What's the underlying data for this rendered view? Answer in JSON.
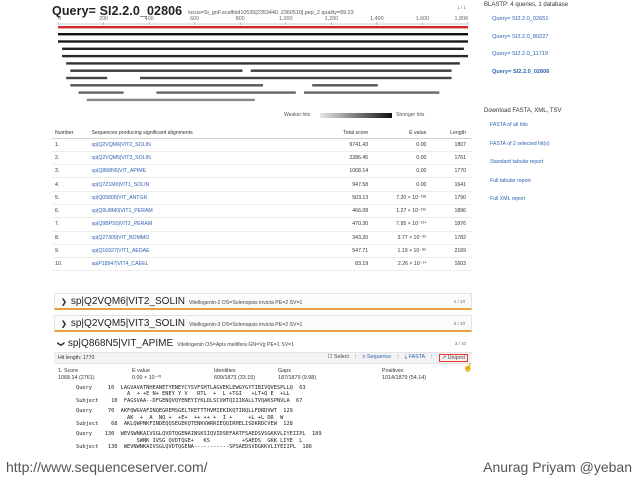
{
  "query": {
    "title": "Query= SI2.2.0_02806",
    "meta": "locus=Si_gnF.scaffold10535[2353440..2360510].pep_2 quality=99.23",
    "nav": "1 / 1",
    "axis_ticks": [
      "0",
      "200",
      "400",
      "600",
      "800",
      "1,000",
      "1,200",
      "1,400",
      "1,600",
      "1,808"
    ],
    "legend_weak": "Weaker hits",
    "legend_strong": "Stronger hits"
  },
  "hits_table": {
    "headers": [
      "Number",
      "Sequences producing significant alignments",
      "Total score",
      "E value",
      "Length"
    ],
    "rows": [
      {
        "num": "1.",
        "acc": "sp|Q2VQM6|VIT2_SOLIN",
        "score": "9741.43",
        "evalue": "0.00",
        "length": "1807"
      },
      {
        "num": "2.",
        "acc": "sp|Q2VQM5|VIT3_SOLIN",
        "score": "2286.45",
        "evalue": "0.00",
        "length": "1761"
      },
      {
        "num": "3.",
        "acc": "sp|Q868N5|VIT_APIME",
        "score": "1068.14",
        "evalue": "0.00",
        "length": "1770"
      },
      {
        "num": "4.",
        "acc": "sp|Q7Z1M0|VIT1_SOLIN",
        "score": "947.58",
        "evalue": "0.00",
        "length": "1641"
      },
      {
        "num": "5.",
        "acc": "sp|Q05808|VIT_ANTGR",
        "score": "503.13",
        "evalue": "7.20 × 10⁻¹³⁸",
        "length": "1790"
      },
      {
        "num": "6.",
        "acc": "sp|Q9U8M0|VIT1_PERAM",
        "score": "466.08",
        "evalue": "1.27 × 10⁻¹²⁶",
        "length": "1896"
      },
      {
        "num": "7.",
        "acc": "sp|Q9BPS0|VIT2_PERAM",
        "score": "470.30",
        "evalue": "7.95 × 10⁻¹²⁴",
        "length": "1876"
      },
      {
        "num": "8.",
        "acc": "sp|Q27309|VIT_BOMMO",
        "score": "343.20",
        "evalue": "3.77 × 10⁻⁹⁰",
        "length": "1782"
      },
      {
        "num": "9.",
        "acc": "sp|Q16927|VIT1_AEDAE",
        "score": "547.71",
        "evalue": "1.19 × 10⁻⁸⁶",
        "length": "2169"
      },
      {
        "num": "10.",
        "acc": "sp|P18947|VIT4_CAEEL",
        "score": "83.19",
        "evalue": "2.26 × 10⁻¹⁴",
        "length": "1603"
      }
    ]
  },
  "hit_panels": [
    {
      "acc": "sp|Q2VQM6|VIT2_SOLIN",
      "desc": "Vitellogenin-2 OS=Solenopsis invicta PE=2 SV=1",
      "count": "1 / 10"
    },
    {
      "acc": "sp|Q2VQM5|VIT3_SOLIN",
      "desc": "Vitellogenin-3 OS=Solenopsis invicta PE=2 SV=1",
      "count": "2 / 10"
    }
  ],
  "expanded_hit": {
    "acc": "sp|Q868N5|VIT_APIME",
    "desc": "Vitellogenin OS=Apis mellifera GN=Vg PE=1 SV=1",
    "count": "3 / 10",
    "length": "Hit length: 1770",
    "actions": {
      "select": "Select",
      "sequence": "Sequence",
      "fasta": "FASTA",
      "uniprot": "Uniprot"
    },
    "stats_labels": [
      "1. Score",
      "E value",
      "Identities",
      "Gaps",
      "Positives"
    ],
    "stats_values": [
      "1068.14 (2761)",
      "0.00 × 10⁻⁰¹",
      "609/1873 (33.15)",
      "187/1879 (9.98)",
      "1014/1879 (54.14)"
    ],
    "alignment": [
      [
        "Query     10  LAGVAVATNHEANETYENEYCYSVFSHTLAGVEKLEWGYGYTIBIVQVESPLLQ  63",
        "                A  + +E N+ ENEY Y V   RTL  +  L +TGI   +LT+Q E  +LL",
        "Subject    10  FAGSVAA--DFGENQVQYENEYIYKLDLSCVWTQIIIKALLTVQAKSPNVLA  67"
      ],
      [
        "Query     70  AKFQWGVAFINQEGREMSGELTKETTTHVMIEKIKQTIRQLLFDRDVWT  129",
        "                AK  +  A  NQ +  +E+  ++ ++ +  I +     +L +L DR  W",
        "Subject    68  AKLQWPNKFINDEQQSEGEKQTENKVWRRIEQQIRHELISDKRDCVEW  128"
      ],
      [
        "Query    130  WEVSWNKAIVSGLQVDTQGENAINSKSIQVIDSEFAATFSAEDSVSGKKVLIYEIIPL  189",
        "                   SWNK IVSG QVDTQGE+   KS          +SAEDS  GKK LIYE  L",
        "Subject   130  WEVNWNKAIVSGLQVDTQGENA-----------SPSAEDSVDGKKVLIYEIIPL  186"
      ]
    ]
  },
  "sidebar": {
    "title": "BLASTP: 4 queries, 1 database",
    "query_links": [
      "Query= SI2.2.0_02651",
      "Query= SI2.2.0_80227",
      "Query= SI2.2.0_11719",
      "Query= SI2.2.0_02806"
    ],
    "download_title": "Download FASTA, XML, TSV",
    "download_links": [
      "FASTA of all hits",
      "FASTA of 2 selected hit(s)",
      "Standard tabular report",
      "Full tabular report",
      "Full XML report"
    ]
  },
  "footer": {
    "left": "http://www.sequenceserver.com/",
    "right": "Anurag Priyam @yeban"
  },
  "colors": {
    "accent_link": "#2f63b3",
    "query_line": "#d62728",
    "panel_border": "#e9a23b"
  }
}
